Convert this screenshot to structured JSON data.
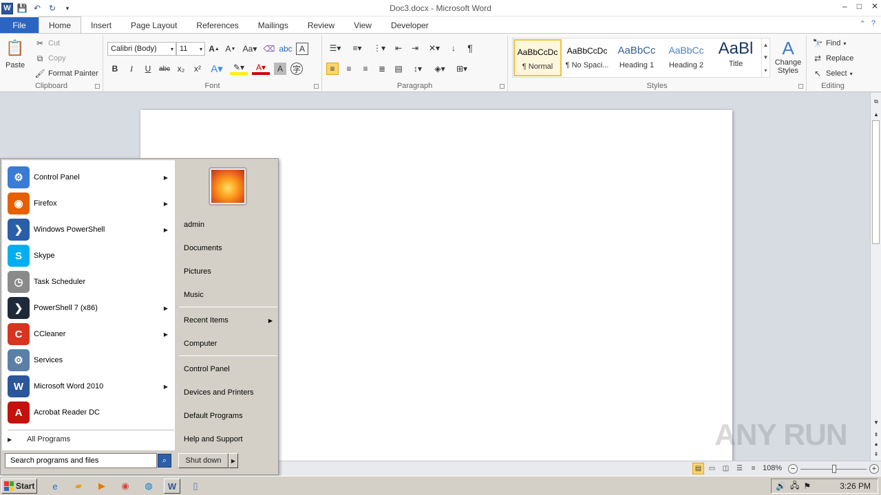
{
  "window": {
    "title": "Doc3.docx - Microsoft Word",
    "controls": [
      "–",
      "□",
      "✕"
    ]
  },
  "qat": {
    "logo": "W",
    "save": "💾",
    "undo": "↶",
    "redo": "↻",
    "customize": "▾"
  },
  "ribbon_tabs": [
    "File",
    "Home",
    "Insert",
    "Page Layout",
    "References",
    "Mailings",
    "Review",
    "View",
    "Developer"
  ],
  "active_tab": "Home",
  "clipboard": {
    "label": "Clipboard",
    "paste": "Paste",
    "cut": "Cut",
    "copy": "Copy",
    "format_painter": "Format Painter"
  },
  "font": {
    "label": "Font",
    "family": "Calibri (Body)",
    "size": "11",
    "format_buttons": [
      "B",
      "I",
      "U",
      "abc",
      "x₂",
      "x²"
    ]
  },
  "paragraph": {
    "label": "Paragraph"
  },
  "styles": {
    "label": "Styles",
    "items": [
      {
        "sample": "AaBbCcDc",
        "name": "¶ Normal"
      },
      {
        "sample": "AaBbCcDc",
        "name": "¶ No Spaci..."
      },
      {
        "sample": "AaBbCc",
        "name": "Heading 1"
      },
      {
        "sample": "AaBbCc",
        "name": "Heading 2"
      },
      {
        "sample": "AaBl",
        "name": "Title"
      }
    ],
    "change_styles": "Change Styles"
  },
  "editing": {
    "label": "Editing",
    "find": "Find",
    "replace": "Replace",
    "select": "Select"
  },
  "status": {
    "zoom": "108%"
  },
  "watermark": "ANY RUN",
  "start_menu": {
    "programs": [
      {
        "name": "Control Panel",
        "icon": "control-panel-icon",
        "color": "#3a7bd5",
        "has_submenu": true
      },
      {
        "name": "Firefox",
        "icon": "firefox-icon",
        "color": "#e66000",
        "has_submenu": true
      },
      {
        "name": "Windows PowerShell",
        "icon": "powershell-icon",
        "color": "#2a5ea8",
        "has_submenu": true
      },
      {
        "name": "Skype",
        "icon": "skype-icon",
        "color": "#00aff0",
        "has_submenu": false
      },
      {
        "name": "Task Scheduler",
        "icon": "clock-icon",
        "color": "#8a8a8a",
        "has_submenu": false
      },
      {
        "name": "PowerShell 7 (x86)",
        "icon": "powershell7-icon",
        "color": "#1e2a3a",
        "has_submenu": true
      },
      {
        "name": "CCleaner",
        "icon": "ccleaner-icon",
        "color": "#d9341f",
        "has_submenu": true
      },
      {
        "name": "Services",
        "icon": "gears-icon",
        "color": "#5c7fa8",
        "has_submenu": false
      },
      {
        "name": "Microsoft Word 2010",
        "icon": "word-icon",
        "color": "#2b579a",
        "has_submenu": true
      },
      {
        "name": "Acrobat Reader DC",
        "icon": "acrobat-icon",
        "color": "#c4110b",
        "has_submenu": false
      }
    ],
    "all_programs": "All Programs",
    "search_placeholder": "Search programs and files",
    "right_items_top": [
      "admin",
      "Documents",
      "Pictures",
      "Music"
    ],
    "right_items_mid": [
      {
        "name": "Recent Items",
        "has_submenu": true
      },
      {
        "name": "Computer",
        "has_submenu": false
      }
    ],
    "right_items_bottom": [
      "Control Panel",
      "Devices and Printers",
      "Default Programs",
      "Help and Support"
    ],
    "shutdown": "Shut down"
  },
  "taskbar": {
    "start": "Start",
    "clock": "3:26 PM",
    "apps": [
      "ie-icon",
      "explorer-icon",
      "media-player-icon",
      "chrome-icon",
      "edge-icon",
      "word-icon",
      "notepad-icon"
    ]
  }
}
